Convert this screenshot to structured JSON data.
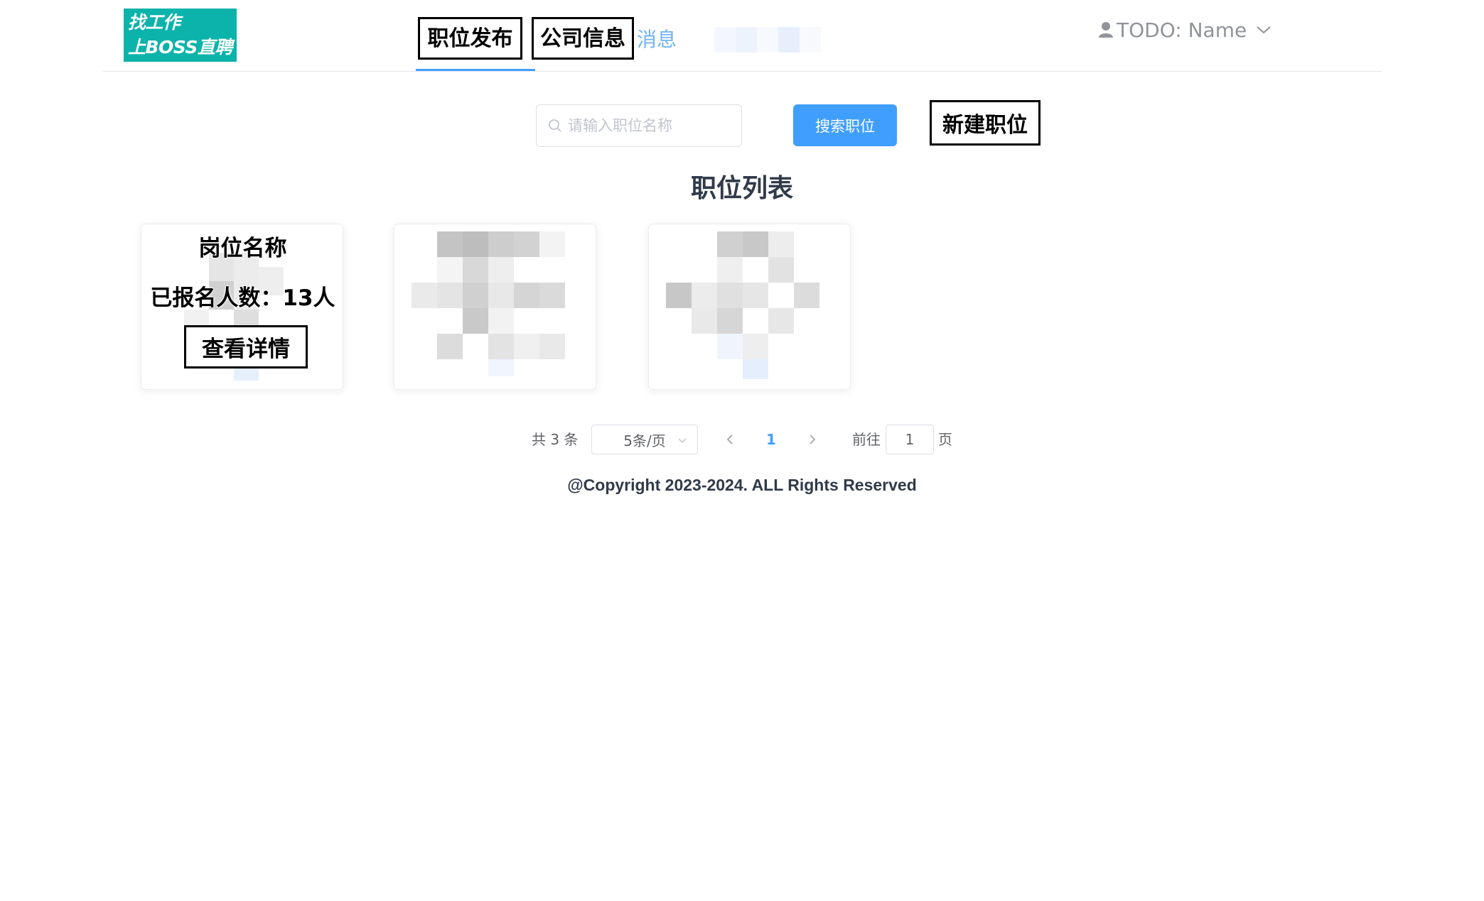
{
  "header": {
    "logo": {
      "line1": "找工作",
      "line2": "上BOSS直聘",
      "color": "#0bb3ab"
    },
    "nav": [
      {
        "label": "职位发布",
        "active": true
      },
      {
        "label": "公司信息",
        "active": false
      },
      {
        "label": "消息",
        "active": false
      }
    ],
    "user": {
      "name": "TODO: Name",
      "icon": "user-icon",
      "menu_icon": "chevron-down-icon"
    }
  },
  "toolbar": {
    "search_placeholder": "请输入职位名称",
    "search_button": "搜索职位",
    "new_button": "新建职位"
  },
  "list": {
    "title": "职位列表",
    "cards": [
      {
        "title": "岗位名称",
        "count_text": "已报名人数：13人",
        "detail_button": "查看详情"
      }
    ]
  },
  "pagination": {
    "total_text": "共 3 条",
    "page_size": "5条/页",
    "current_page": "1",
    "goto_label": "前往",
    "goto_value": "1",
    "goto_unit": "页"
  },
  "footer": {
    "copyright": "@Copyright 2023-2024. ALL Rights Reserved"
  },
  "colors": {
    "primary": "#409eff",
    "title": "#303a4a",
    "border": "#dcdfe6"
  }
}
